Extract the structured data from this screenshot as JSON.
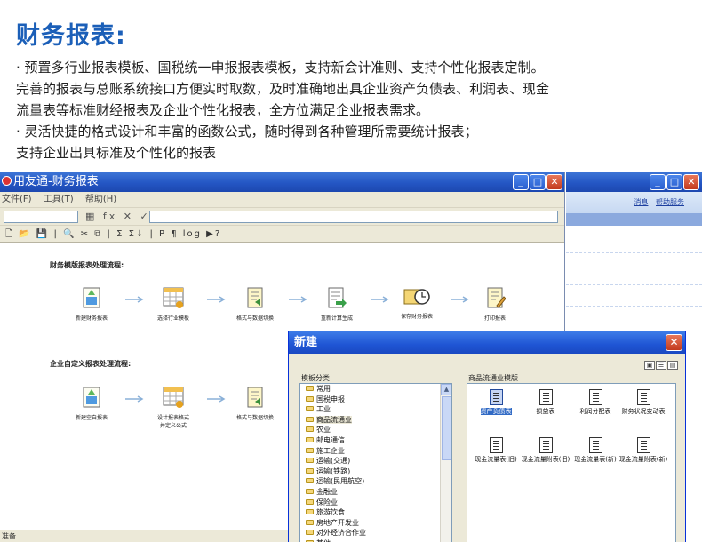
{
  "heading": "财务报表:",
  "desc_lines": [
    "· 预置多行业报表模板、国税统一申报报表模板，支持新会计准则、支持个性化报表定制。",
    "完善的报表与总账系统接口方便实时取数，及时准确地出具企业资产负债表、利润表、现金",
    "流量表等标准财经报表及企业个性化报表，全方位满足企业报表需求。",
    "· 灵活快捷的格式设计和丰富的函数公式，随时得到各种管理所需要统计报表；",
    "支持企业出具标准及个性化的报表"
  ],
  "main_window": {
    "title": "用友通-财务报表",
    "menu": [
      "文件(F)",
      "工具(T)",
      "帮助(H)"
    ],
    "formula_symbols": "▦ fx ✕ ✓",
    "toolbar_glyphs": "🗋 📂 💾 | 🔍 ✂ ⧉ | Σ Σ↓ | P ¶ log ▶?",
    "flow1_title": "财务模版报表处理流程:",
    "flow1_steps": [
      "新建财务报表",
      "选择行业模板",
      "格式与数据切换",
      "重新计算生成",
      "保存财务报表",
      "打印报表"
    ],
    "flow2_title": "企业自定义报表处理流程:",
    "flow2_steps": [
      "新建空白报表",
      "设计报表格式\n并定义公式",
      "格式与数据切换"
    ],
    "status": "准备"
  },
  "right_window": {
    "links": [
      "消息",
      "帮助服务"
    ]
  },
  "dialog": {
    "title": "新建",
    "category_label": "模板分类",
    "template_label": "商品流通业模版",
    "categories": [
      "常用",
      "国税申报",
      "工业",
      "商品流通业",
      "农业",
      "邮电通信",
      "施工企业",
      "运输(交通)",
      "运输(铁路)",
      "运输(民用航空)",
      "金融业",
      "保险业",
      "旅游饮食",
      "房地产开发业",
      "对外经济合作业",
      "其他"
    ],
    "selected_category": "商品流通业",
    "templates": [
      "资产负债表",
      "损益表",
      "利润分配表",
      "财务状况变动表",
      "现金流量表(旧)",
      "现金流量附表(旧)",
      "现金流量表(新)",
      "现金流量附表(新)"
    ],
    "selected_template": "资产负债表",
    "view_buttons": [
      "▣",
      "☰",
      "▤"
    ]
  },
  "colors": {
    "heading": "#1b5fb8",
    "titlebar": "#2456c4",
    "selection": "#316ac5"
  }
}
